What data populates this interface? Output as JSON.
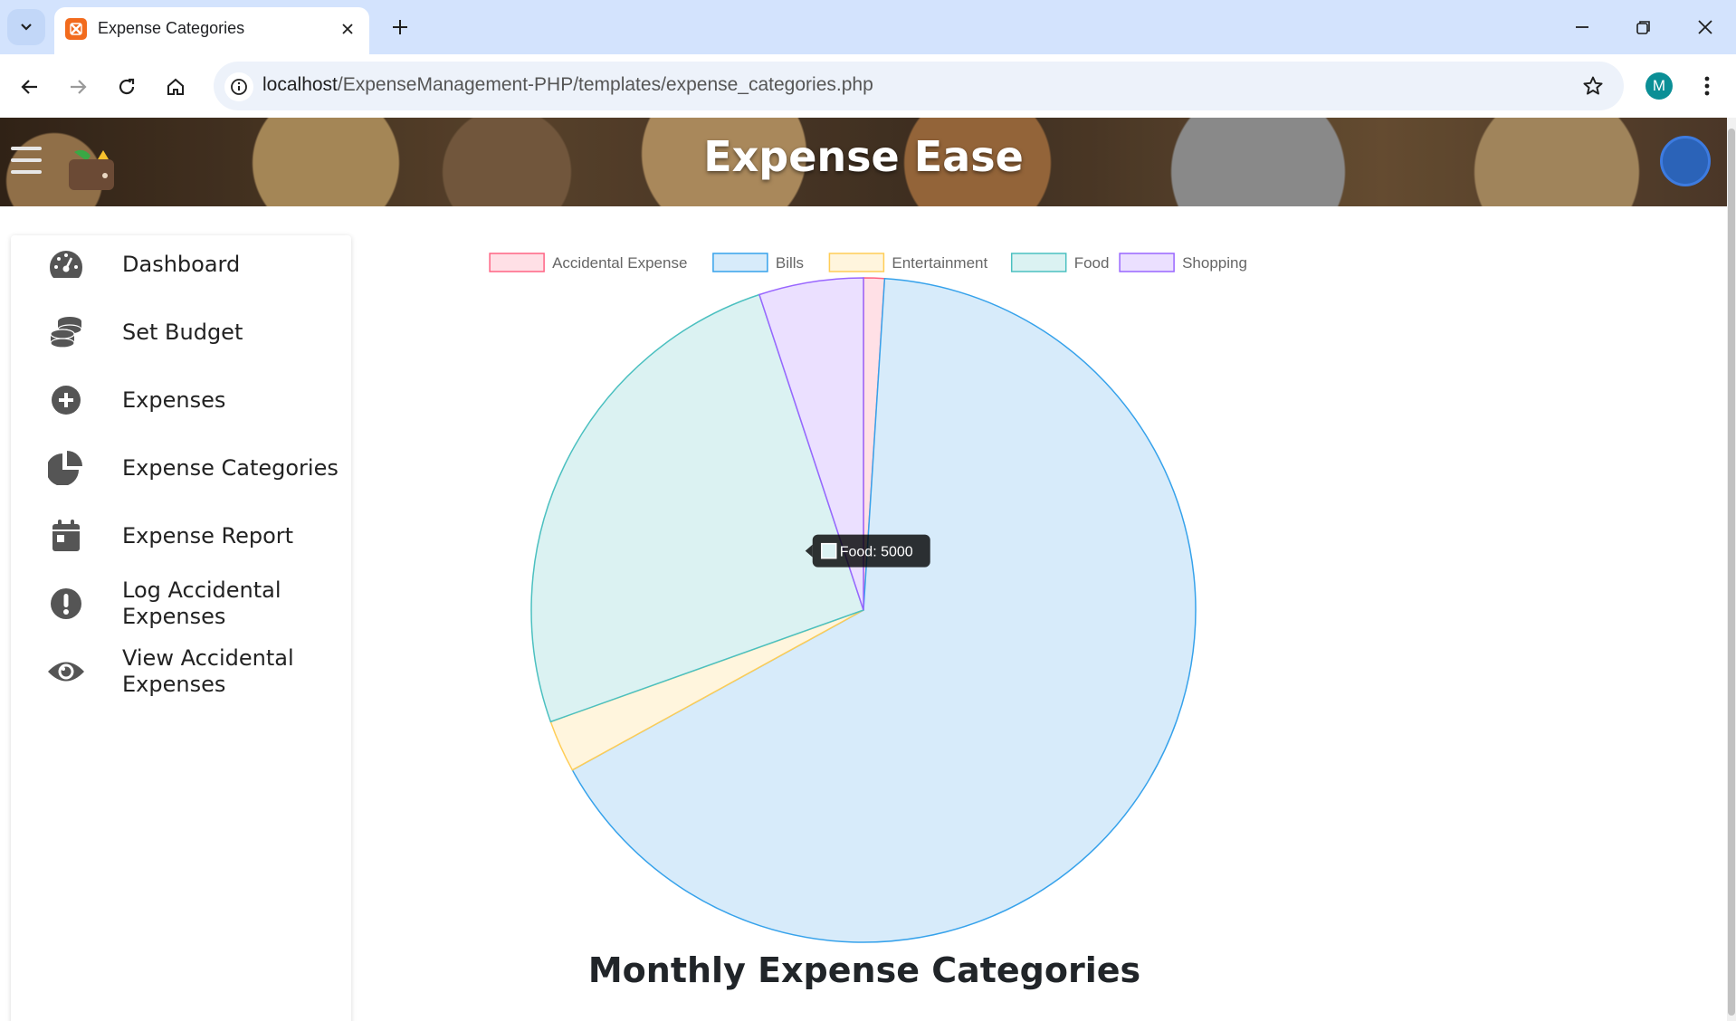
{
  "browser": {
    "tab_title": "Expense Categories",
    "url_host": "localhost",
    "url_path": "/ExpenseManagement-PHP/templates/expense_categories.php",
    "profile_initial": "M"
  },
  "header": {
    "brand": "Expense Ease"
  },
  "sidebar": {
    "items": [
      {
        "label": "Dashboard",
        "icon": "gauge-icon"
      },
      {
        "label": "Set Budget",
        "icon": "coins-icon"
      },
      {
        "label": "Expenses",
        "icon": "plus-circle-icon"
      },
      {
        "label": "Expense Categories",
        "icon": "pie-chart-icon"
      },
      {
        "label": "Expense Report",
        "icon": "calendar-icon"
      },
      {
        "label": "Log Accidental Expenses",
        "icon": "exclamation-circle-icon"
      },
      {
        "label": "View Accidental Expenses",
        "icon": "eye-icon"
      }
    ]
  },
  "main": {
    "title": "Monthly Expense Categories"
  },
  "chart_data": {
    "type": "pie",
    "categories": [
      "Accidental Expense",
      "Bills",
      "Entertainment",
      "Food",
      "Shopping"
    ],
    "values": [
      200,
      13000,
      500,
      5000,
      1000
    ],
    "colors": {
      "fill": [
        "#ffe0e6",
        "#d7ebfa",
        "#fff5dd",
        "#dbf2f2",
        "#ebe0ff"
      ],
      "border": [
        "#ff6384",
        "#36a2eb",
        "#ffcd56",
        "#4bc0c0",
        "#9966ff"
      ]
    },
    "legend_position": "top",
    "tooltip": {
      "label": "Food: 5000"
    }
  }
}
